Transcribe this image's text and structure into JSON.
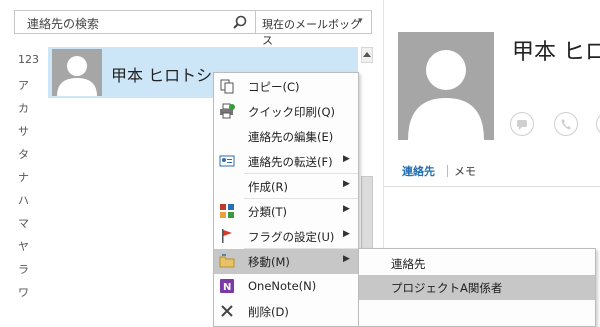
{
  "search": {
    "placeholder": "連絡先の検索",
    "scope": "現在のメールボックス"
  },
  "index": [
    "123",
    "ア",
    "カ",
    "サ",
    "タ",
    "ナ",
    "ハ",
    "マ",
    "ヤ",
    "ラ",
    "ワ"
  ],
  "contact": {
    "name": "甲本 ヒロトシ"
  },
  "reading_pane": {
    "name": "甲本 ヒロ",
    "tab_contacts": "連絡先",
    "tab_memo": "メモ"
  },
  "context_menu": {
    "copy": "コピー(C)",
    "quick_print": "クイック印刷(Q)",
    "edit_contact": "連絡先の編集(E)",
    "forward_contact": "連絡先の転送(F)",
    "create": "作成(R)",
    "categorize": "分類(T)",
    "follow_up": "フラグの設定(U)",
    "move": "移動(M)",
    "onenote": "OneNote(N)",
    "delete": "削除(D)"
  },
  "move_submenu": {
    "contacts": "連絡先",
    "project": "プロジェクトA関係者"
  },
  "colors": {
    "selection": "#cde6f7",
    "accent": "#1f6fb5",
    "menu_highlight": "#c7c7c7"
  }
}
